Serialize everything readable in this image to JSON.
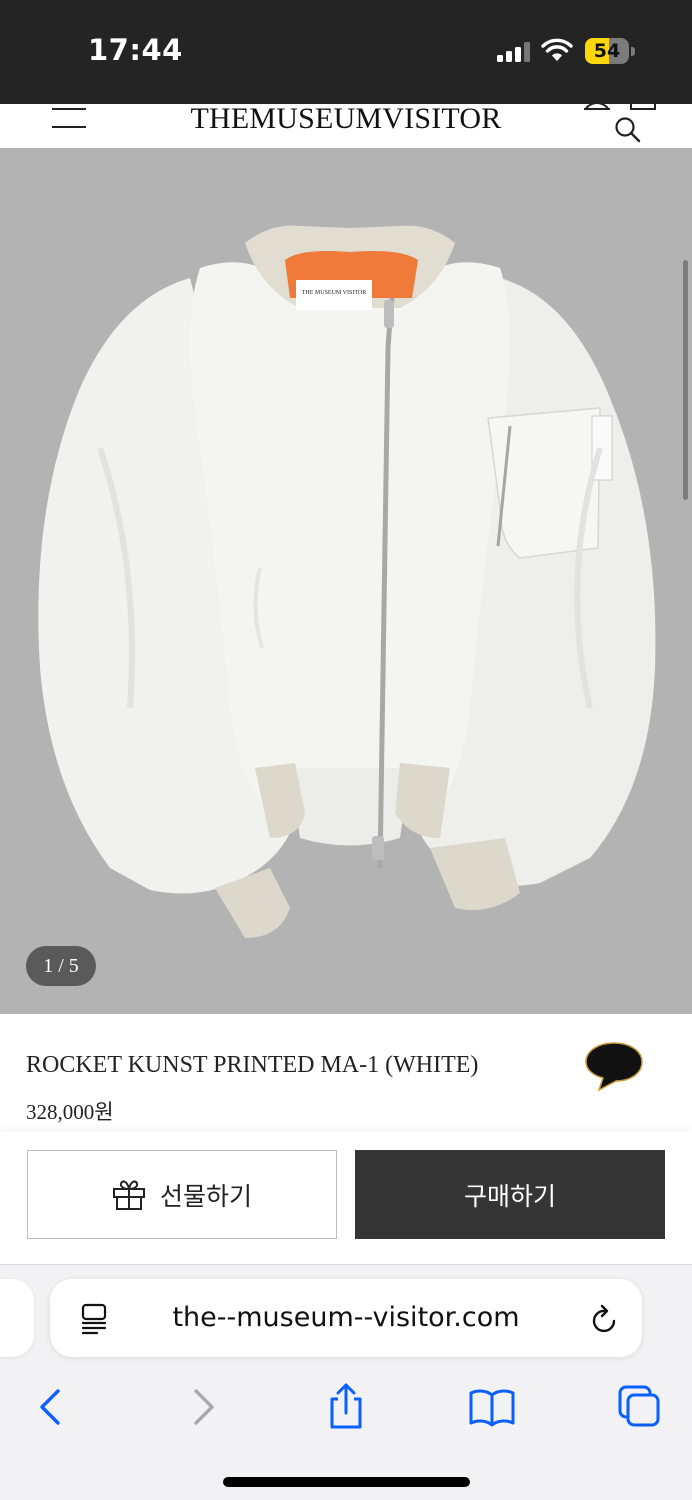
{
  "status_bar": {
    "time": "17:44",
    "battery_level": "54",
    "battery_fraction": 0.54,
    "icons": [
      "signal-icon",
      "wifi-icon",
      "battery-icon"
    ]
  },
  "header": {
    "brand": "THEMUSEUMVISITOR",
    "icons": [
      "menu-icon",
      "account-icon",
      "cart-icon",
      "search-icon"
    ]
  },
  "gallery": {
    "counter": "1 / 5",
    "image_description_icon": "product-photo",
    "label_text": "THE MUSEUM VISITOR"
  },
  "product": {
    "name": "ROCKET KUNST PRINTED MA-1 (WHITE)",
    "price": "328,000원",
    "chat_icon": "chat-bubble-icon"
  },
  "actions": {
    "gift_label": "선물하기",
    "buy_label": "구매하기"
  },
  "browser": {
    "url": "the--museum--visitor.com",
    "icons": [
      "reader-icon",
      "reload-icon",
      "back-icon",
      "forward-icon",
      "share-icon",
      "bookmarks-icon",
      "tabs-icon"
    ]
  },
  "colors": {
    "status_bar": "#242424",
    "battery": "#ffd60a",
    "image_bg": "#b3b3b3",
    "buy_button": "#353535",
    "safari_blue": "#0a60ff",
    "lining_orange": "#f07a3a"
  }
}
